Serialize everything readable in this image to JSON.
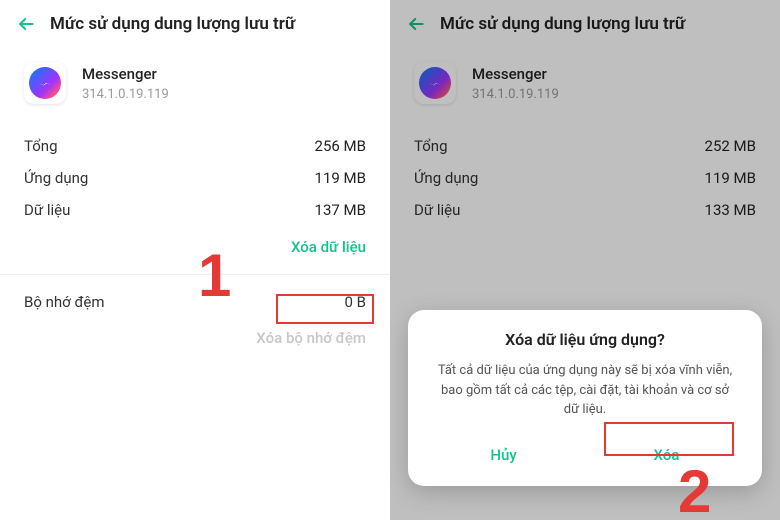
{
  "header": {
    "title": "Mức sử dụng dung lượng lưu trữ"
  },
  "app": {
    "name": "Messenger",
    "version": "314.1.0.19.119"
  },
  "left": {
    "stats": {
      "total_label": "Tổng",
      "total_value": "256 MB",
      "app_label": "Ứng dụng",
      "app_value": "119 MB",
      "data_label": "Dữ liệu",
      "data_value": "137 MB"
    },
    "clear_data": "Xóa dữ liệu",
    "cache_label": "Bộ nhớ đệm",
    "cache_value": "0 B",
    "clear_cache": "Xóa bộ nhớ đệm"
  },
  "right": {
    "stats": {
      "total_label": "Tổng",
      "total_value": "252 MB",
      "app_label": "Ứng dụng",
      "app_value": "119 MB",
      "data_label": "Dữ liệu",
      "data_value": "133 MB"
    }
  },
  "dialog": {
    "title": "Xóa dữ liệu ứng dụng?",
    "body": "Tất cả dữ liệu của ứng dụng này sẽ bị xóa vĩnh viễn, bao gồm tất cả các tệp, cài đặt, tài khoản và cơ sở dữ liệu.",
    "cancel": "Hủy",
    "confirm": "Xóa"
  },
  "annotations": {
    "step1": "1",
    "step2": "2"
  }
}
